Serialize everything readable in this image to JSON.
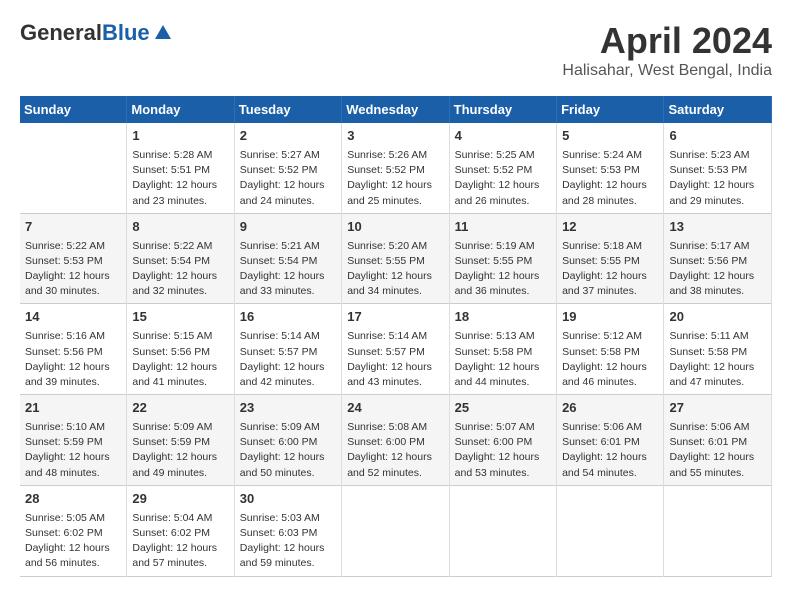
{
  "header": {
    "logo_general": "General",
    "logo_blue": "Blue",
    "month_title": "April 2024",
    "location": "Halisahar, West Bengal, India"
  },
  "days_of_week": [
    "Sunday",
    "Monday",
    "Tuesday",
    "Wednesday",
    "Thursday",
    "Friday",
    "Saturday"
  ],
  "weeks": [
    [
      {
        "day": "",
        "info": ""
      },
      {
        "day": "1",
        "info": "Sunrise: 5:28 AM\nSunset: 5:51 PM\nDaylight: 12 hours\nand 23 minutes."
      },
      {
        "day": "2",
        "info": "Sunrise: 5:27 AM\nSunset: 5:52 PM\nDaylight: 12 hours\nand 24 minutes."
      },
      {
        "day": "3",
        "info": "Sunrise: 5:26 AM\nSunset: 5:52 PM\nDaylight: 12 hours\nand 25 minutes."
      },
      {
        "day": "4",
        "info": "Sunrise: 5:25 AM\nSunset: 5:52 PM\nDaylight: 12 hours\nand 26 minutes."
      },
      {
        "day": "5",
        "info": "Sunrise: 5:24 AM\nSunset: 5:53 PM\nDaylight: 12 hours\nand 28 minutes."
      },
      {
        "day": "6",
        "info": "Sunrise: 5:23 AM\nSunset: 5:53 PM\nDaylight: 12 hours\nand 29 minutes."
      }
    ],
    [
      {
        "day": "7",
        "info": "Sunrise: 5:22 AM\nSunset: 5:53 PM\nDaylight: 12 hours\nand 30 minutes."
      },
      {
        "day": "8",
        "info": "Sunrise: 5:22 AM\nSunset: 5:54 PM\nDaylight: 12 hours\nand 32 minutes."
      },
      {
        "day": "9",
        "info": "Sunrise: 5:21 AM\nSunset: 5:54 PM\nDaylight: 12 hours\nand 33 minutes."
      },
      {
        "day": "10",
        "info": "Sunrise: 5:20 AM\nSunset: 5:55 PM\nDaylight: 12 hours\nand 34 minutes."
      },
      {
        "day": "11",
        "info": "Sunrise: 5:19 AM\nSunset: 5:55 PM\nDaylight: 12 hours\nand 36 minutes."
      },
      {
        "day": "12",
        "info": "Sunrise: 5:18 AM\nSunset: 5:55 PM\nDaylight: 12 hours\nand 37 minutes."
      },
      {
        "day": "13",
        "info": "Sunrise: 5:17 AM\nSunset: 5:56 PM\nDaylight: 12 hours\nand 38 minutes."
      }
    ],
    [
      {
        "day": "14",
        "info": "Sunrise: 5:16 AM\nSunset: 5:56 PM\nDaylight: 12 hours\nand 39 minutes."
      },
      {
        "day": "15",
        "info": "Sunrise: 5:15 AM\nSunset: 5:56 PM\nDaylight: 12 hours\nand 41 minutes."
      },
      {
        "day": "16",
        "info": "Sunrise: 5:14 AM\nSunset: 5:57 PM\nDaylight: 12 hours\nand 42 minutes."
      },
      {
        "day": "17",
        "info": "Sunrise: 5:14 AM\nSunset: 5:57 PM\nDaylight: 12 hours\nand 43 minutes."
      },
      {
        "day": "18",
        "info": "Sunrise: 5:13 AM\nSunset: 5:58 PM\nDaylight: 12 hours\nand 44 minutes."
      },
      {
        "day": "19",
        "info": "Sunrise: 5:12 AM\nSunset: 5:58 PM\nDaylight: 12 hours\nand 46 minutes."
      },
      {
        "day": "20",
        "info": "Sunrise: 5:11 AM\nSunset: 5:58 PM\nDaylight: 12 hours\nand 47 minutes."
      }
    ],
    [
      {
        "day": "21",
        "info": "Sunrise: 5:10 AM\nSunset: 5:59 PM\nDaylight: 12 hours\nand 48 minutes."
      },
      {
        "day": "22",
        "info": "Sunrise: 5:09 AM\nSunset: 5:59 PM\nDaylight: 12 hours\nand 49 minutes."
      },
      {
        "day": "23",
        "info": "Sunrise: 5:09 AM\nSunset: 6:00 PM\nDaylight: 12 hours\nand 50 minutes."
      },
      {
        "day": "24",
        "info": "Sunrise: 5:08 AM\nSunset: 6:00 PM\nDaylight: 12 hours\nand 52 minutes."
      },
      {
        "day": "25",
        "info": "Sunrise: 5:07 AM\nSunset: 6:00 PM\nDaylight: 12 hours\nand 53 minutes."
      },
      {
        "day": "26",
        "info": "Sunrise: 5:06 AM\nSunset: 6:01 PM\nDaylight: 12 hours\nand 54 minutes."
      },
      {
        "day": "27",
        "info": "Sunrise: 5:06 AM\nSunset: 6:01 PM\nDaylight: 12 hours\nand 55 minutes."
      }
    ],
    [
      {
        "day": "28",
        "info": "Sunrise: 5:05 AM\nSunset: 6:02 PM\nDaylight: 12 hours\nand 56 minutes."
      },
      {
        "day": "29",
        "info": "Sunrise: 5:04 AM\nSunset: 6:02 PM\nDaylight: 12 hours\nand 57 minutes."
      },
      {
        "day": "30",
        "info": "Sunrise: 5:03 AM\nSunset: 6:03 PM\nDaylight: 12 hours\nand 59 minutes."
      },
      {
        "day": "",
        "info": ""
      },
      {
        "day": "",
        "info": ""
      },
      {
        "day": "",
        "info": ""
      },
      {
        "day": "",
        "info": ""
      }
    ]
  ]
}
